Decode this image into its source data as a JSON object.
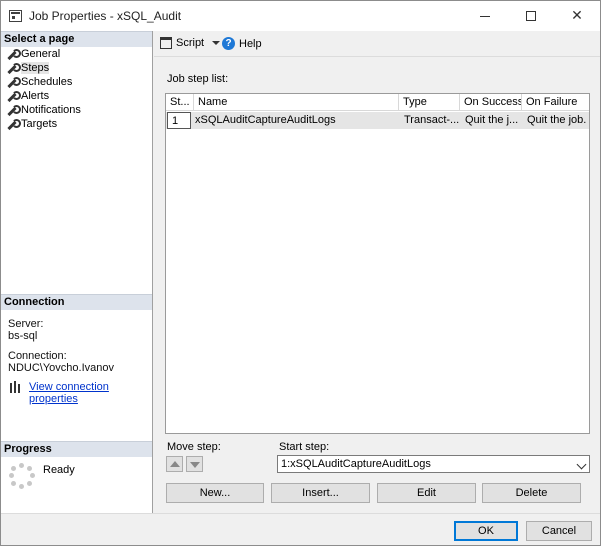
{
  "window": {
    "title": "Job Properties - xSQL_Audit"
  },
  "left_panel": {
    "select_page_header": "Select a page",
    "pages": [
      {
        "label": "General",
        "selected": false
      },
      {
        "label": "Steps",
        "selected": true
      },
      {
        "label": "Schedules",
        "selected": false
      },
      {
        "label": "Alerts",
        "selected": false
      },
      {
        "label": "Notifications",
        "selected": false
      },
      {
        "label": "Targets",
        "selected": false
      }
    ],
    "connection_header": "Connection",
    "server_label": "Server:",
    "server_value": "bs-sql",
    "connection_label": "Connection:",
    "connection_value": "NDUC\\Yovcho.Ivanov",
    "view_connection_link": "View connection properties",
    "progress_header": "Progress",
    "progress_status": "Ready"
  },
  "toolbar": {
    "script_label": "Script",
    "help_label": "Help"
  },
  "main": {
    "job_step_list_label": "Job step list:",
    "columns": [
      "St...",
      "Name",
      "Type",
      "On Success",
      "On Failure"
    ],
    "rows": [
      {
        "step": "1",
        "name": "xSQLAuditCaptureAuditLogs",
        "type": "Transact-...",
        "on_success": "Quit the j...",
        "on_failure": "Quit the job..."
      }
    ],
    "move_step_label": "Move step:",
    "start_step_label": "Start step:",
    "start_step_value": "1:xSQLAuditCaptureAuditLogs",
    "buttons": {
      "new": "New...",
      "insert": "Insert...",
      "edit": "Edit",
      "delete": "Delete"
    }
  },
  "footer": {
    "ok": "OK",
    "cancel": "Cancel"
  },
  "colors": {
    "accent": "#0078d7",
    "link": "#0033cc",
    "section_header": "#dde3ec"
  }
}
